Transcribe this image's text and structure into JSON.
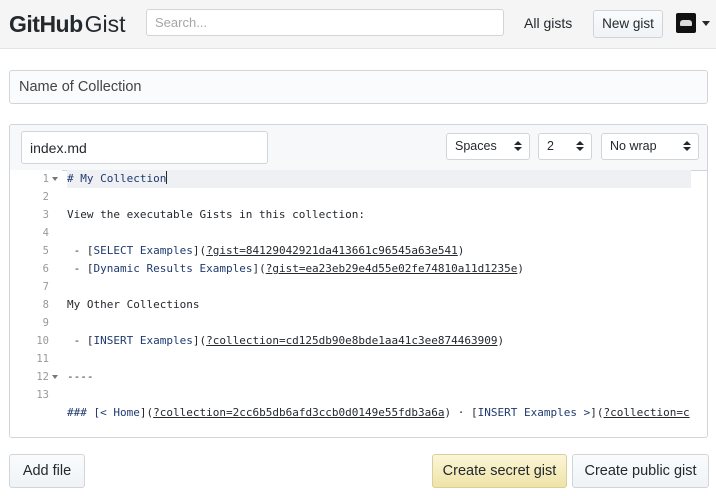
{
  "header": {
    "logo_github": "GitHub",
    "logo_gist": "Gist",
    "search_placeholder": "Search...",
    "all_gists": "All gists",
    "new_gist": "New gist"
  },
  "collection": {
    "name_placeholder": "Name of Collection"
  },
  "file": {
    "filename": "index.md",
    "indent_mode": "Spaces",
    "indent_size": "2",
    "wrap_mode": "No wrap"
  },
  "editor": {
    "line_numbers": [
      "1",
      "2",
      "3",
      "4",
      "5",
      "6",
      "7",
      "8",
      "9",
      "10",
      "11",
      "12",
      "13"
    ],
    "lines": {
      "l1": "# My Collection",
      "l3": "View the executable Gists in this collection:",
      "l5_prefix": " - [",
      "l5_text": "SELECT Examples",
      "l5_mid": "](",
      "l5_url": "?gist=84129042921da413661c96545a63e541",
      "l5_end": ")",
      "l6_prefix": " - [",
      "l6_text": "Dynamic Results Examples",
      "l6_mid": "](",
      "l6_url": "?gist=ea23eb29e4d55e02fe74810a11d1235e",
      "l6_end": ")",
      "l8": "My Other Collections",
      "l10_prefix": " - [",
      "l10_text": "INSERT Examples",
      "l10_mid": "](",
      "l10_url": "?collection=cd125db90e8bde1aa41c3ee874463909",
      "l10_end": ")",
      "l12": "----",
      "l14_hash": "### [",
      "l14_text1": "< Home",
      "l14_mid1": "](",
      "l14_url1": "?collection=2cc6b5db6afd3ccb0d0149e55fdb3a6a",
      "l14_sep": ") · [",
      "l14_text2": "INSERT Examples >",
      "l14_mid2": "](",
      "l14_url2": "?collection=c"
    }
  },
  "actions": {
    "add_file": "Add file",
    "create_secret": "Create secret gist",
    "create_public": "Create public gist"
  },
  "colors": {
    "header_bg": "#f5f5f5",
    "secret_button_bg": "#efe3a6",
    "link_text": "#1f3a6e"
  },
  "icons": {
    "fold_markers": "triangle-down",
    "select_arrows": "up-down-arrows",
    "user_menu": "caret-down"
  }
}
